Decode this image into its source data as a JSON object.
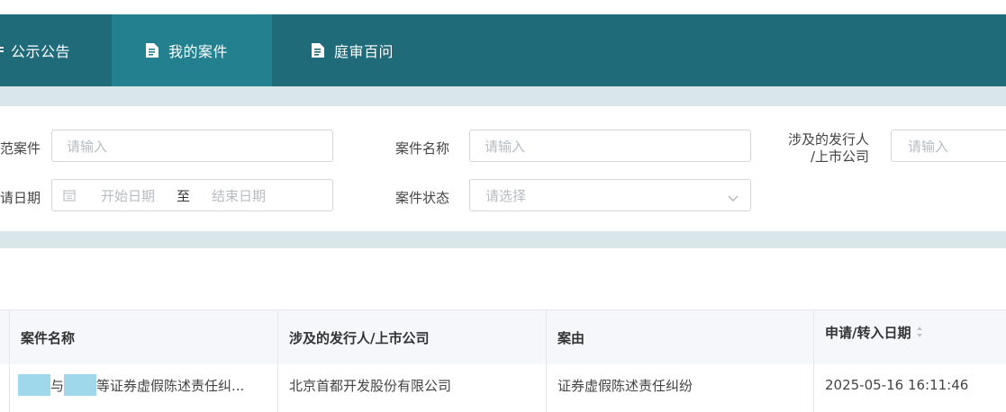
{
  "nav": {
    "items": [
      {
        "label": "公示公告",
        "icon": "list-icon"
      },
      {
        "label": "我的案件",
        "icon": "document-icon",
        "active": true
      },
      {
        "label": "庭审百问",
        "icon": "document-icon"
      }
    ],
    "colors": {
      "bar": "#1f6b7a",
      "active": "#23808f"
    }
  },
  "filters": {
    "row1": [
      {
        "label": "范案件",
        "placeholder": "请输入"
      },
      {
        "label": "案件名称",
        "placeholder": "请输入"
      },
      {
        "label": "涉及的发行人/上市公司",
        "label_lines": [
          "涉及的发行人",
          "/上市公司"
        ],
        "placeholder": "请输入"
      }
    ],
    "row2": {
      "date_label": "请日期",
      "start_placeholder": "开始日期",
      "separator": "至",
      "end_placeholder": "结束日期",
      "status_label": "案件状态",
      "status_placeholder": "请选择"
    }
  },
  "table": {
    "headers": [
      "案件名称",
      "涉及的发行人/上市公司",
      "案由",
      "申请/转入日期"
    ],
    "rows": [
      {
        "name_mid": "与",
        "name_tail": "等证券虚假陈述责任纠...",
        "company": "北京首都开发股份有限公司",
        "cause": "证券虚假陈述责任纠纷",
        "date": "2025-05-16 16:11:46"
      }
    ]
  }
}
